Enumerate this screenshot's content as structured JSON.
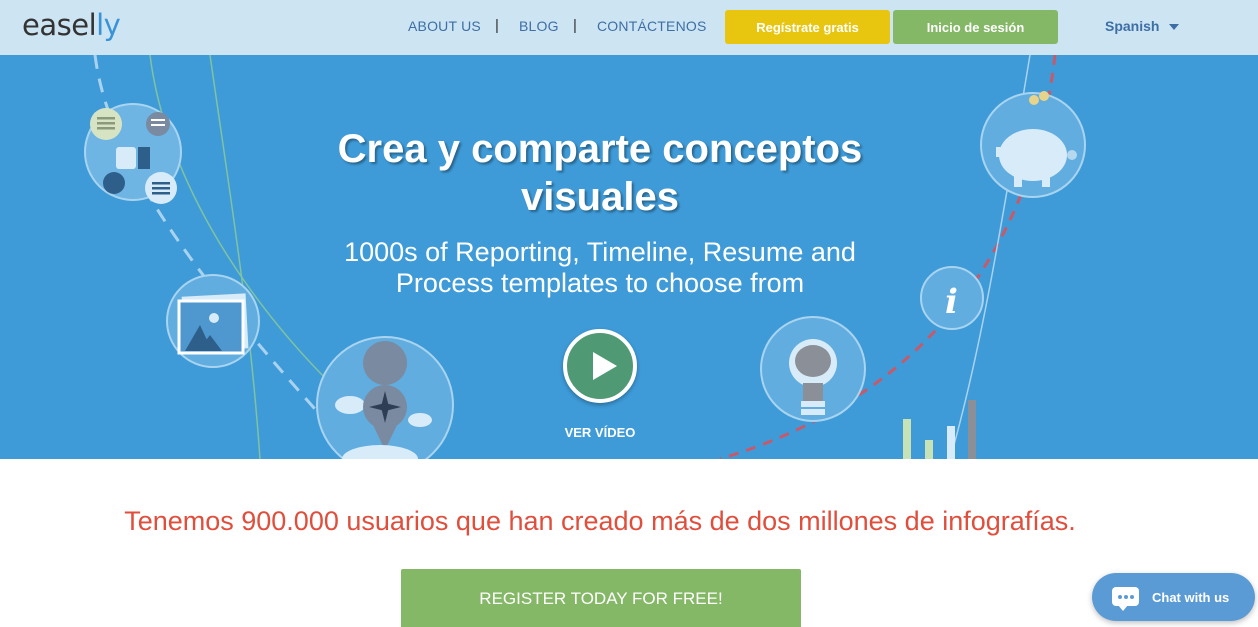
{
  "header": {
    "logo_main": "easel",
    "logo_accent": "ly",
    "nav": [
      "ABOUT US",
      "BLOG",
      "CONTÁCTENOS"
    ],
    "separator": "|",
    "register_button": "Regístrate gratis",
    "login_button": "Inicio de sesión",
    "language": "Spanish"
  },
  "hero": {
    "title_line1": "Crea y comparte conceptos",
    "title_line2": "visuales",
    "subtitle_line1": "1000s of Reporting, Timeline, Resume and",
    "subtitle_line2": "Process templates to choose from",
    "video_label": "VER VÍDEO"
  },
  "stats": {
    "text": "Tenemos 900.000 usuarios que han creado más de dos millones de infografías."
  },
  "cta": {
    "register_label": "REGISTER TODAY FOR FREE!"
  },
  "chat": {
    "label": "Chat with us"
  },
  "colors": {
    "header_bg": "#cde4f3",
    "hero_bg": "#3e9bd8",
    "register_yellow": "#e8c50e",
    "login_green": "#84b866",
    "stat_red": "#e04e3c",
    "chat_blue": "#5b9bd5"
  }
}
